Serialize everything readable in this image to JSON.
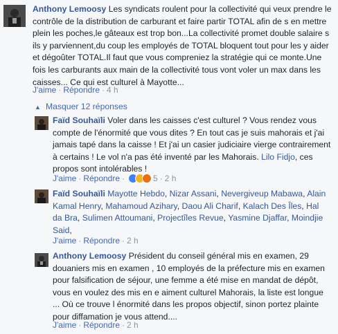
{
  "comments": [
    {
      "author": "Anthony Lemoosy",
      "text": "Les syndicats roulent pour la collectivité qui veux prendre le contrôle de la distribution de carburant et faire partir TOTAL afin de s en mettre plein les poches,le gâteaux est trop bon...La collectivité promet double salaire s ils y parviennent,du coup les employés de TOTAL bloquent tout pour les y aider et dégoûter TOTAL.Il faut que vous compreniez la stratégie qui ce monte.Une fois les carburants aux main de la collectivité tous vont voler un max dans les caisses... Ce qui est culturel à Mayotte...",
      "like_label": "J'aime",
      "reply_label": "Répondre",
      "time": "4 h"
    }
  ],
  "toggle": {
    "label": "Masquer 12 réponses"
  },
  "replies": [
    {
      "author": "Faïd Souhaïli",
      "text": "Voler dans les caisses c'est culturel ? Vous rendez vous compte de l'énormité que vous dites ? En tout cas je suis mahorais et j'ai jamais tapé dans la caisse ! Et j'ai un casier judiciaire vierge contrairement à certains ! Le vol n'a pas été inventé par les Mahorais.",
      "mention": "Lilo Fidjo",
      "text_after": ", ces propos sont intolérables !",
      "like_label": "J'aime",
      "reply_label": "Répondre",
      "reaction_count": "5",
      "time": "2 h"
    },
    {
      "author": "Faïd Souhaïli",
      "mentions": [
        "Mayotte Hebdo",
        "Nizar Assani",
        "Nevergiveup Mabawa",
        "Alain Kamal Henry",
        "Mahamoud Azihary",
        "Daou Ali Charif",
        "Kalach Des Îles",
        "Hal da Bra",
        "Sulimen Attoumani",
        "Projectîles Revue",
        "Yasmine Djaffar",
        "Moindjie Said"
      ],
      "like_label": "J'aime",
      "reply_label": "Répondre",
      "time": "2 h"
    },
    {
      "author": "Anthony Lemoosy",
      "text": "Président du conseil général mis en examen, 29 douaniers mis en examen , 10 employés de la préfecture mis en examen pour falsification de séjour, une femme a été mise en mandat de dépôt, vous en voulez des mis en e aiment culturel Mahorais, la liste est longue ... Où ce trouve l énormité dans les propos objectif, sinon portez plainte pour diffamation je vous attend....",
      "like_label": "J'aime",
      "reply_label": "Répondre",
      "time": "2 h"
    }
  ]
}
